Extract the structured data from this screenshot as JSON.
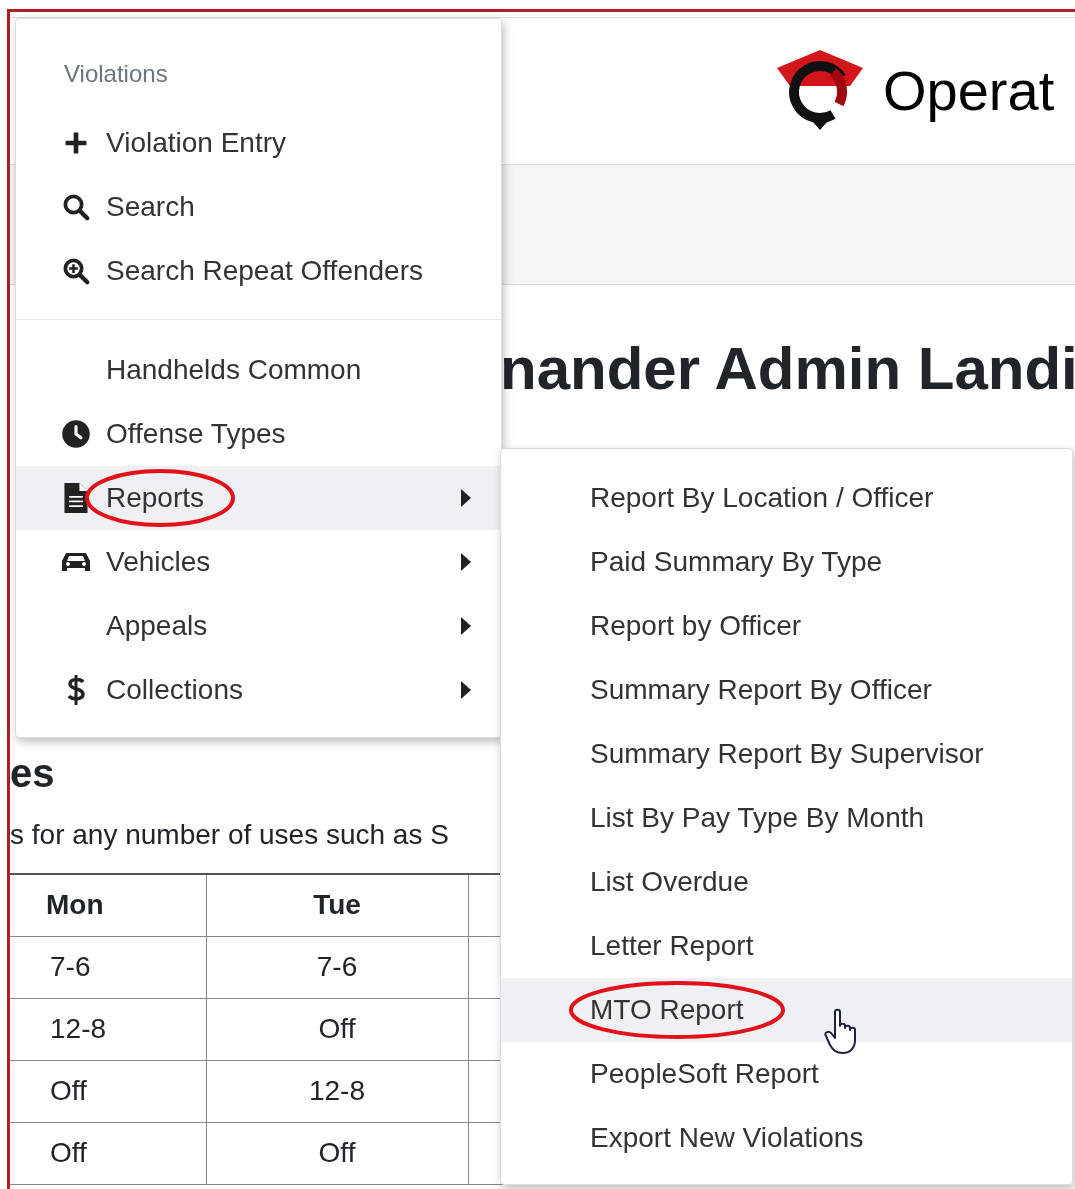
{
  "header": {
    "brand": "Operat"
  },
  "page": {
    "heading": "nander Admin Landi",
    "section_heading": "es",
    "paragraph": "s for any number of uses such as S",
    "table": {
      "columns": [
        "Mon",
        "Tue"
      ],
      "rows": [
        [
          "7-6",
          "7-6"
        ],
        [
          "12-8",
          "Off"
        ],
        [
          "Off",
          "12-8"
        ],
        [
          "Off",
          "Off"
        ]
      ]
    }
  },
  "menu": {
    "section_label": "Violations",
    "groups": [
      {
        "items": [
          {
            "label": "Violation Entry",
            "has_submenu": false,
            "selected": false,
            "circled": false
          },
          {
            "label": "Search",
            "has_submenu": false,
            "selected": false,
            "circled": false
          },
          {
            "label": "Search Repeat Offenders",
            "has_submenu": false,
            "selected": false,
            "circled": false
          }
        ]
      },
      {
        "items": [
          {
            "label": "Handhelds Common",
            "has_submenu": false,
            "selected": false,
            "circled": false
          },
          {
            "label": "Offense Types",
            "has_submenu": false,
            "selected": false,
            "circled": false
          },
          {
            "label": "Reports",
            "has_submenu": true,
            "selected": true,
            "circled": true
          },
          {
            "label": "Vehicles",
            "has_submenu": true,
            "selected": false,
            "circled": false
          },
          {
            "label": "Appeals",
            "has_submenu": true,
            "selected": false,
            "circled": false
          },
          {
            "label": "Collections",
            "has_submenu": true,
            "selected": false,
            "circled": false
          }
        ]
      }
    ]
  },
  "submenu": {
    "items": [
      {
        "label": "Report By Location / Officer",
        "selected": false,
        "circled": false
      },
      {
        "label": "Paid Summary By Type",
        "selected": false,
        "circled": false
      },
      {
        "label": "Report by Officer",
        "selected": false,
        "circled": false
      },
      {
        "label": "Summary Report By Officer",
        "selected": false,
        "circled": false
      },
      {
        "label": "Summary Report By Supervisor",
        "selected": false,
        "circled": false
      },
      {
        "label": "List By Pay Type By Month",
        "selected": false,
        "circled": false
      },
      {
        "label": "List Overdue",
        "selected": false,
        "circled": false
      },
      {
        "label": "Letter Report",
        "selected": false,
        "circled": false
      },
      {
        "label": "MTO Report",
        "selected": true,
        "circled": true
      },
      {
        "label": "PeopleSoft Report",
        "selected": false,
        "circled": false
      },
      {
        "label": "Export New Violations",
        "selected": false,
        "circled": false
      }
    ]
  }
}
